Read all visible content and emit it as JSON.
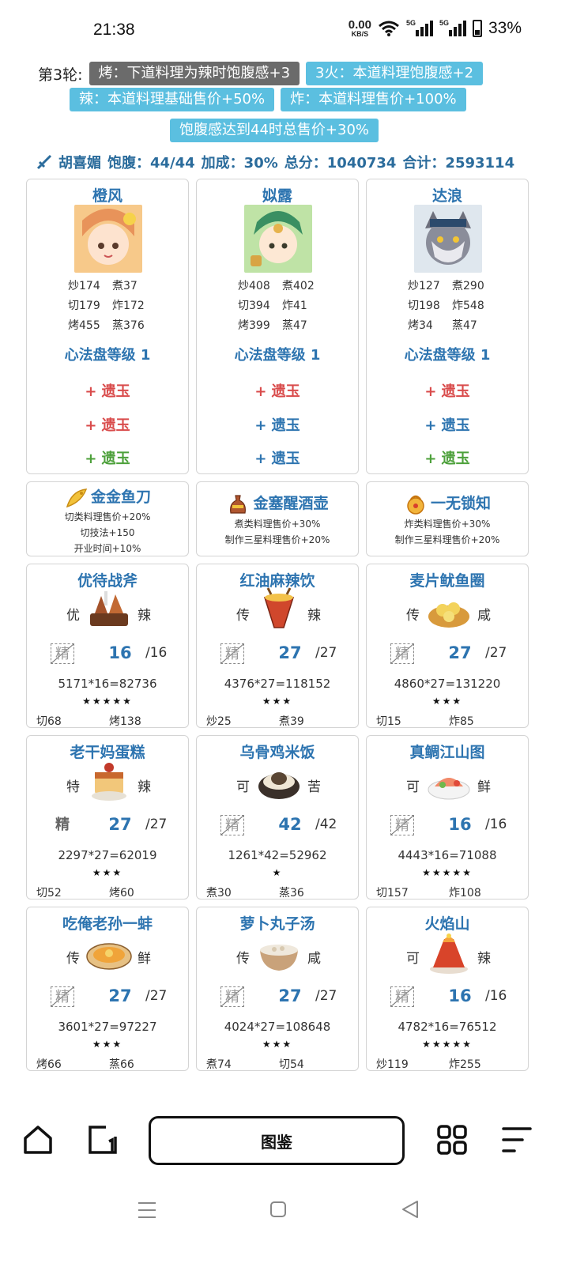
{
  "status_bar": {
    "time": "21:38",
    "net_speed": "0.00",
    "net_unit": "KB/S",
    "sim1": "5G",
    "sim2": "5G",
    "battery": "33%"
  },
  "rules": {
    "round": "第3轮:",
    "chips": [
      {
        "text": "烤：下道料理为辣时饱腹感+3",
        "color": "#6b6b6b"
      },
      {
        "text": "3火：本道料理饱腹感+2",
        "color": "#5bbfe0"
      },
      {
        "text": "辣：本道料理基础售价+50%",
        "color": "#5bbfe0"
      },
      {
        "text": "炸：本道料理售价+100%",
        "color": "#5bbfe0"
      },
      {
        "text": "饱腹感达到44时总售价+30%",
        "color": "#5bbfe0"
      }
    ]
  },
  "summary": {
    "guest": "胡喜媚",
    "satiety": "饱腹：44/44",
    "bonus": "加成：30%",
    "score": "总分：1040734",
    "total": "合计：2593114"
  },
  "chefs": [
    {
      "name": "橙风",
      "skills": [
        "炒174",
        "煮37",
        "切179",
        "炸172",
        "烤455",
        "蒸376"
      ],
      "level": "心法盘等级 1",
      "relics": [
        {
          "text": "+ 遗玉",
          "color": "red"
        },
        {
          "text": "+ 遗玉",
          "color": "red"
        },
        {
          "text": "+ 遗玉",
          "color": "green"
        }
      ]
    },
    {
      "name": "姒露",
      "skills": [
        "炒408",
        "煮402",
        "切394",
        "炸41",
        "烤399",
        "蒸47"
      ],
      "level": "心法盘等级 1",
      "relics": [
        {
          "text": "+ 遗玉",
          "color": "red"
        },
        {
          "text": "+ 遗玉",
          "color": "blue"
        },
        {
          "text": "+ 遗玉",
          "color": "blue"
        }
      ]
    },
    {
      "name": "达浪",
      "skills": [
        "炒127",
        "煮290",
        "切198",
        "炸548",
        "烤34",
        "蒸47"
      ],
      "level": "心法盘等级 1",
      "relics": [
        {
          "text": "+ 遗玉",
          "color": "red"
        },
        {
          "text": "+ 遗玉",
          "color": "blue"
        },
        {
          "text": "+ 遗玉",
          "color": "green"
        }
      ]
    }
  ],
  "equipment": [
    {
      "name": "金金鱼刀",
      "icon": "golden-fish-knife-icon",
      "effects": [
        "切类料理售价+20%",
        "切技法+150",
        "开业时间+10%"
      ]
    },
    {
      "name": "金塞醒酒壶",
      "icon": "wine-pot-icon",
      "effects": [
        "煮类料理售价+30%",
        "制作三星料理售价+20%"
      ]
    },
    {
      "name": "一无锁知",
      "icon": "golden-lock-icon",
      "effects": [
        "炸类料理售价+30%",
        "制作三星料理售价+20%"
      ]
    }
  ],
  "dishes": [
    {
      "name": "优待战斧",
      "left": "优",
      "right": "辣",
      "jing": "精",
      "jing_style": "boxed",
      "qty": "16",
      "max": "/16",
      "calc": "5171*16=82736",
      "stars": "★★★★★",
      "skills": [
        "切68",
        "烤138"
      ],
      "icon": "steak-dish-icon"
    },
    {
      "name": "红油麻辣饮",
      "left": "传",
      "right": "辣",
      "jing": "精",
      "jing_style": "boxed",
      "qty": "27",
      "max": "/27",
      "calc": "4376*27=118152",
      "stars": "★★★",
      "skills": [
        "炒25",
        "煮39"
      ],
      "icon": "spicy-drink-icon"
    },
    {
      "name": "麦片鱿鱼圈",
      "left": "传",
      "right": "咸",
      "jing": "精",
      "jing_style": "boxed",
      "qty": "27",
      "max": "/27",
      "calc": "4860*27=131220",
      "stars": "★★★",
      "skills": [
        "切15",
        "炸85"
      ],
      "icon": "squid-rings-icon"
    },
    {
      "name": "老干妈蛋糕",
      "left": "特",
      "right": "辣",
      "jing": "精",
      "jing_style": "plain",
      "qty": "27",
      "max": "/27",
      "calc": "2297*27=62019",
      "stars": "★★★",
      "skills": [
        "切52",
        "烤60"
      ],
      "icon": "cake-icon"
    },
    {
      "name": "乌骨鸡米饭",
      "left": "可",
      "right": "苦",
      "jing": "精",
      "jing_style": "boxed",
      "qty": "42",
      "max": "/42",
      "calc": "1261*42=52962",
      "stars": "★",
      "skills": [
        "煮30",
        "蒸36"
      ],
      "icon": "chicken-rice-icon"
    },
    {
      "name": "真鲷江山图",
      "left": "可",
      "right": "鲜",
      "jing": "精",
      "jing_style": "boxed",
      "qty": "16",
      "max": "/16",
      "calc": "4443*16=71088",
      "stars": "★★★★★",
      "skills": [
        "切157",
        "炸108"
      ],
      "icon": "sashimi-platter-icon"
    },
    {
      "name": "吃俺老孙一蚌",
      "left": "传",
      "right": "鲜",
      "jing": "精",
      "jing_style": "boxed",
      "qty": "27",
      "max": "/27",
      "calc": "3601*27=97227",
      "stars": "★★★",
      "skills": [
        "烤66",
        "蒸66"
      ],
      "icon": "clam-dish-icon"
    },
    {
      "name": "萝卜丸子汤",
      "left": "传",
      "right": "咸",
      "jing": "精",
      "jing_style": "boxed",
      "qty": "27",
      "max": "/27",
      "calc": "4024*27=108648",
      "stars": "★★★",
      "skills": [
        "煮74",
        "切54"
      ],
      "icon": "soup-bowl-icon"
    },
    {
      "name": "火焰山",
      "left": "可",
      "right": "辣",
      "jing": "精",
      "jing_style": "boxed",
      "qty": "16",
      "max": "/16",
      "calc": "4782*16=76512",
      "stars": "★★★★★",
      "skills": [
        "炒119",
        "炸255"
      ],
      "icon": "volcano-dish-icon"
    }
  ],
  "bottom_nav": {
    "center_label": "图鉴",
    "icons": [
      "home-icon",
      "tab-switch-icon",
      "apps-grid-icon",
      "menu-icon"
    ]
  },
  "system_nav": {
    "icons": [
      "recent-apps-icon",
      "home-circle-icon",
      "back-triangle-icon"
    ]
  }
}
